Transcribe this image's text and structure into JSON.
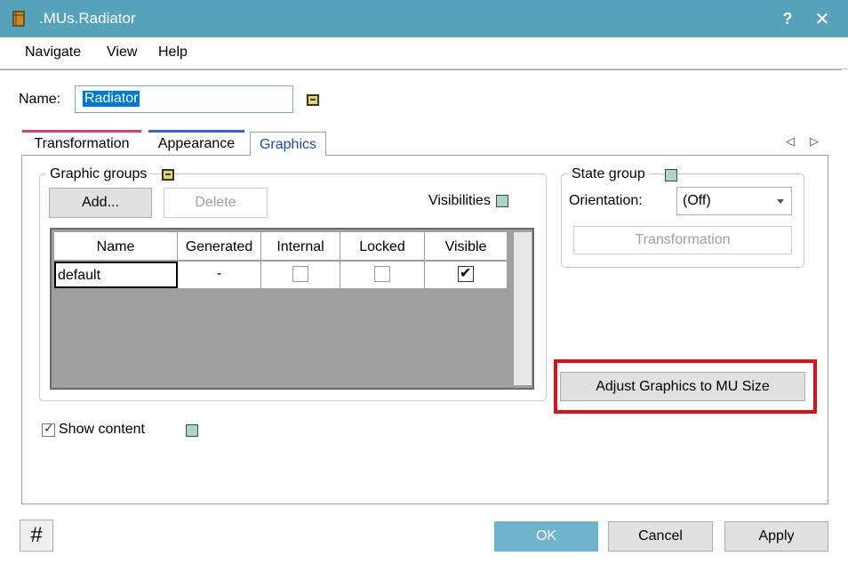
{
  "window": {
    "title": ".MUs.Radiator",
    "help_glyph": "?",
    "close_glyph": "✕",
    "icon": "cube-icon"
  },
  "menu": {
    "items": [
      {
        "label": "Navigate"
      },
      {
        "label": "View"
      },
      {
        "label": "Help"
      }
    ]
  },
  "name": {
    "label": "Name:",
    "value": "Radiator"
  },
  "tabs": [
    {
      "label": "Transformation",
      "accent": "#d6406e"
    },
    {
      "label": "Appearance",
      "accent": "#3b5fd6"
    },
    {
      "label": "Graphics",
      "active": true
    }
  ],
  "tab_scroll": {
    "left": "◁",
    "right": "▷"
  },
  "graphic_groups": {
    "label": "Graphic groups",
    "add_label": "Add...",
    "delete_label": "Delete",
    "visibilities_label": "Visibilities",
    "columns": [
      "Name",
      "Generated",
      "Internal",
      "Locked",
      "Visible"
    ],
    "rows": [
      {
        "name": "default",
        "generated": "-",
        "internal": false,
        "locked": false,
        "visible": true
      }
    ]
  },
  "state_group": {
    "label": "State group",
    "orientation_label": "Orientation:",
    "orientation_value": "(Off)",
    "transformation_label": "Transformation"
  },
  "adjust_button": {
    "label": "Adjust Graphics to MU Size"
  },
  "show_content": {
    "label": "Show content",
    "checked": true
  },
  "footer": {
    "grid_glyph": "#",
    "ok_label": "OK",
    "cancel_label": "Cancel",
    "apply_label": "Apply"
  },
  "colors": {
    "titlebar": "#56a2bb",
    "ok_button": "#6fb3cc",
    "highlight": "#e0101a"
  }
}
